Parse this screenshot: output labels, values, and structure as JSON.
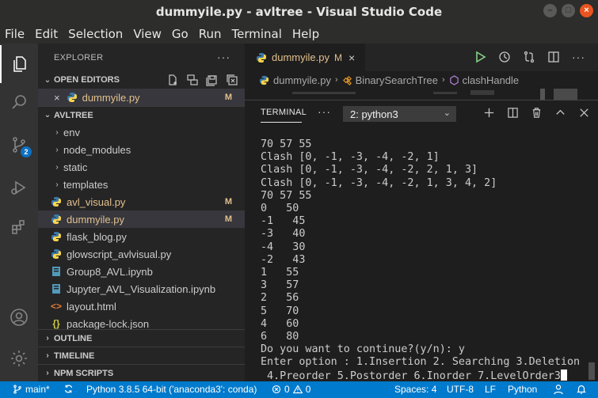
{
  "window": {
    "title": "dummyile.py - avltree - Visual Studio Code"
  },
  "menu": [
    "File",
    "Edit",
    "Selection",
    "View",
    "Go",
    "Run",
    "Terminal",
    "Help"
  ],
  "activity": {
    "scm_badge": "2"
  },
  "explorer": {
    "title": "EXPLORER",
    "open_editors": {
      "header": "OPEN EDITORS",
      "items": [
        {
          "name": "dummyile.py",
          "status": "M"
        }
      ]
    },
    "folder": {
      "header": "AVLTREE",
      "items": [
        {
          "name": "env",
          "type": "folder"
        },
        {
          "name": "node_modules",
          "type": "folder"
        },
        {
          "name": "static",
          "type": "folder"
        },
        {
          "name": "templates",
          "type": "folder"
        },
        {
          "name": "avl_visual.py",
          "type": "python",
          "status": "M"
        },
        {
          "name": "dummyile.py",
          "type": "python",
          "status": "M"
        },
        {
          "name": "flask_blog.py",
          "type": "python"
        },
        {
          "name": "glowscript_avlvisual.py",
          "type": "python"
        },
        {
          "name": "Group8_AVL.ipynb",
          "type": "notebook"
        },
        {
          "name": "Jupyter_AVL_Visualization.ipynb",
          "type": "notebook"
        },
        {
          "name": "layout.html",
          "type": "html"
        },
        {
          "name": "package-lock.json",
          "type": "json"
        }
      ]
    },
    "outline": "OUTLINE",
    "timeline": "TIMELINE",
    "npm_scripts": "NPM SCRIPTS"
  },
  "editor": {
    "tab": {
      "label": "dummyile.py",
      "status": "M",
      "close": "×"
    },
    "breadcrumb": [
      "dummyile.py",
      "BinarySearchTree",
      "clashHandle"
    ]
  },
  "panel": {
    "tab": "TERMINAL",
    "terminal_select": "2: python3",
    "lines": [
      "70 57 55",
      "Clash [0, -1, -3, -4, -2, 1]",
      "Clash [0, -1, -3, -4, -2, 2, 1, 3]",
      "Clash [0, -1, -3, -4, -2, 1, 3, 4, 2]",
      "70 57 55",
      "0   50",
      "-1   45",
      "-3   40",
      "-4   30",
      "-2   43",
      "1   55",
      "3   57",
      "2   56",
      "5   70",
      "4   60",
      "6   80",
      "Do you want to continue?(y/n): y",
      "Enter option : 1.Insertion 2. Searching 3.Deletion",
      " 4.Preorder 5.Postorder 6.Inorder 7.LevelOrder3"
    ]
  },
  "statusbar": {
    "branch": "main*",
    "interpreter": "Python 3.8.5 64-bit ('anaconda3': conda)",
    "errors": "0",
    "warnings": "0",
    "spaces": "Spaces: 4",
    "encoding": "UTF-8",
    "eol": "LF",
    "language": "Python"
  }
}
